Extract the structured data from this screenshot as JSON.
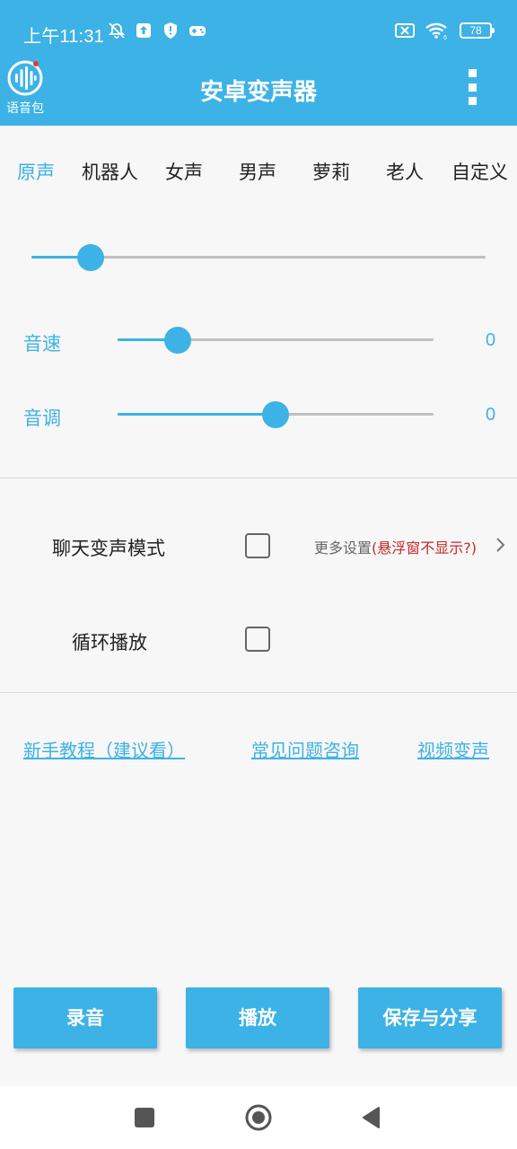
{
  "status_bar": {
    "time": "上午11:31",
    "battery": "78",
    "icons_left": [
      "alarm-off-icon",
      "upload-icon",
      "shield-icon",
      "gamepad-icon"
    ],
    "icons_right": [
      "sim-off-icon",
      "wifi-icon",
      "battery-icon"
    ]
  },
  "app_bar": {
    "title": "安卓变声器",
    "voice_pack_label": "语音包",
    "menu_icon": "more-vert-icon"
  },
  "voice_tabs": {
    "items": [
      "原声",
      "机器人",
      "女声",
      "男声",
      "萝莉",
      "老人",
      "自定义"
    ],
    "selected": "原声"
  },
  "effect_slider": {
    "value_fraction": 0.13
  },
  "speed": {
    "label": "音速",
    "value": "0",
    "value_fraction": 0.19
  },
  "pitch": {
    "label": "音调",
    "value": "0",
    "value_fraction": 0.5
  },
  "options": {
    "chat_mode_label": "聊天变声模式",
    "chat_mode_checked": false,
    "more_settings_prefix": "更多设置",
    "more_settings_note": "(悬浮窗不显示?)",
    "loop_label": "循环播放",
    "loop_checked": false
  },
  "links": {
    "tutorial": "新手教程（建议看）",
    "faq": "常见问题咨询",
    "video": "视频变声"
  },
  "actions": {
    "record": "录音",
    "play": "播放",
    "save_share": "保存与分享"
  },
  "colors": {
    "accent": "#3db2e6",
    "warning": "#c62828"
  }
}
